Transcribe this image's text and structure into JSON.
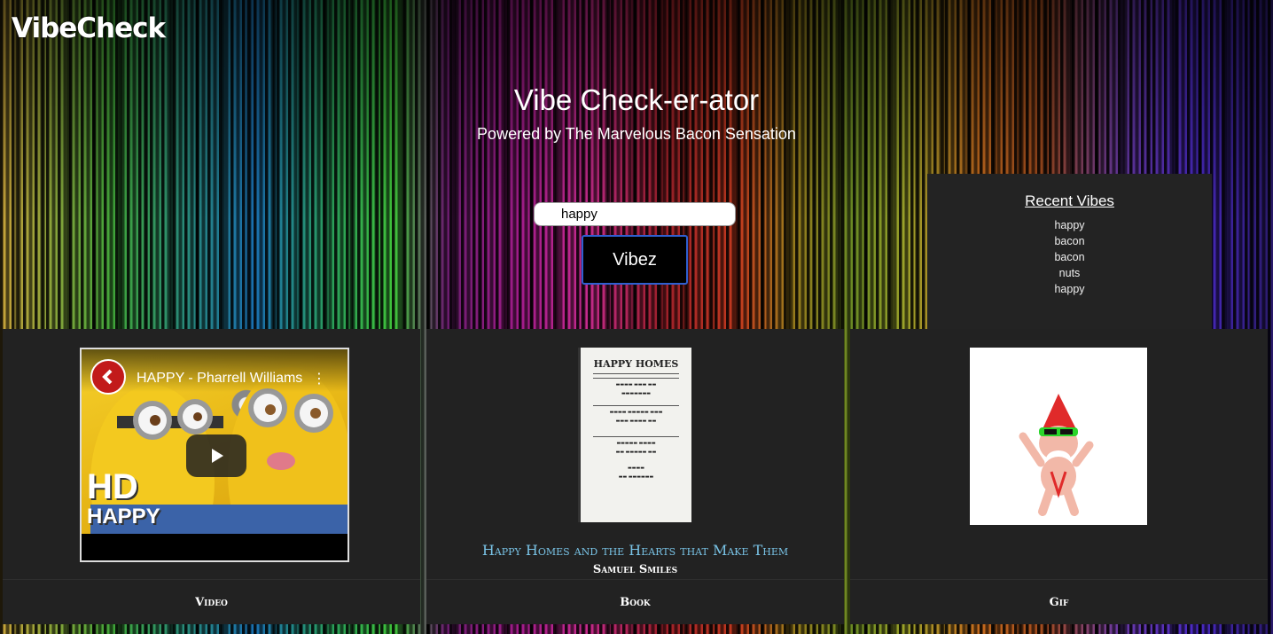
{
  "brand": {
    "logo_text": "VibeCheck"
  },
  "hero": {
    "title": "Vibe Check-er-ator",
    "subtitle": "Powered by The Marvelous Bacon Sensation"
  },
  "search": {
    "value": "happy",
    "button_label": "Vibez"
  },
  "recent": {
    "title": "Recent Vibes",
    "items": [
      "happy",
      "bacon",
      "bacon",
      "nuts",
      "happy"
    ]
  },
  "cards": {
    "video": {
      "title": "HAPPY - Pharrell Williams",
      "overlay_big": "HD",
      "overlay_small": "HAPPY",
      "footer": "Video"
    },
    "book": {
      "cover_title": "HAPPY HOMES",
      "title": "Happy Homes and the Hearts that Make Them",
      "author": "Samuel Smiles",
      "footer": "Book"
    },
    "gif": {
      "footer": "Gif"
    }
  },
  "icons": {
    "channel": "channel-logo-icon",
    "play": "play-icon",
    "menu": "kebab-menu-icon"
  },
  "colors": {
    "accent_link": "#79c3e6",
    "card_bg": "#222222",
    "button_border": "#2f5fd0"
  }
}
